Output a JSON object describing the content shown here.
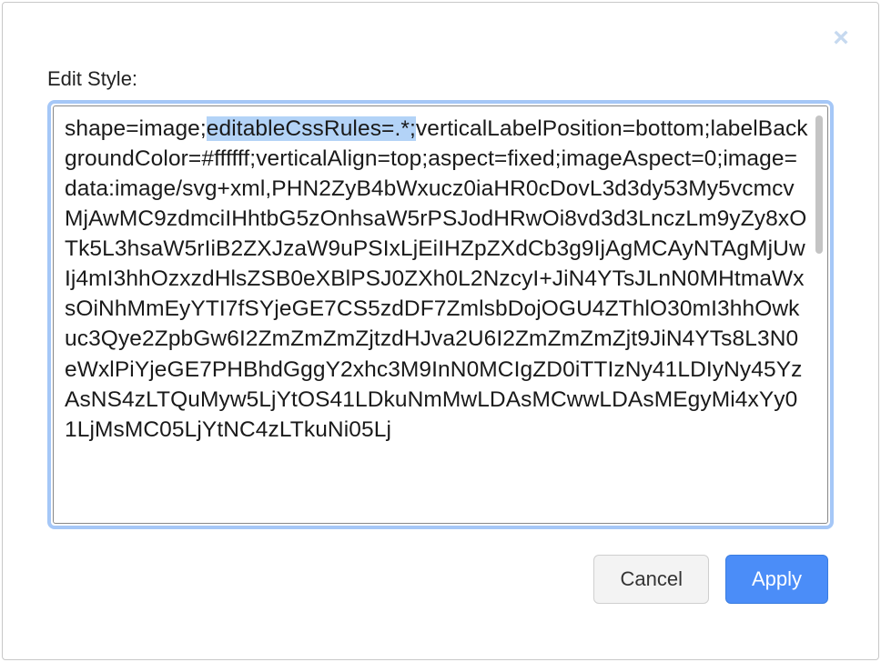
{
  "dialog": {
    "label": "Edit Style:",
    "close_glyph": "×",
    "style_pre": "shape=image;",
    "style_selected": "editableCssRules=.*;",
    "style_post": "verticalLabelPosition=bottom;labelBackgroundColor=#ffffff;verticalAlign=top;aspect=fixed;imageAspect=0;image=data:image/svg+xml,PHN2ZyB4bWxucz0iaHR0cDovL3d3dy53My5vcmcvMjAwMC9zdmciIHhtbG5zOnhsaW5rPSJodHRwOi8vd3d3LnczLm9yZy8xOTk5L3hsaW5rIiB2ZXJzaW9uPSIxLjEiIHZpZXdCb3g9IjAgMCAyNTAgMjUwIj4mI3hhOzxzdHlsZSB0eXBlPSJ0ZXh0L2NzcyI+JiN4YTsJLnN0MHtmaWxsOiNhMmEyYTI7fSYjeGE7CS5zdDF7ZmlsbDojOGU4ZThlO30mI3hhOwkuc3Qye2ZpbGw6I2ZmZmZmZjtzdHJva2U6I2ZmZmZmZjt9JiN4YTs8L3N0eWxlPiYjeGE7PHBhdGggY2xhc3M9InN0MCIgZD0iTTIzNy41LDIyNy45YzAsNS4zLTQuMyw5LjYtOS41LDkuNmMwLDAsMCwwLDAsMEgyMi4xYy01LjMsMC05LjYtNC4zLTkuNi05Lj",
    "buttons": {
      "cancel": "Cancel",
      "apply": "Apply"
    }
  }
}
